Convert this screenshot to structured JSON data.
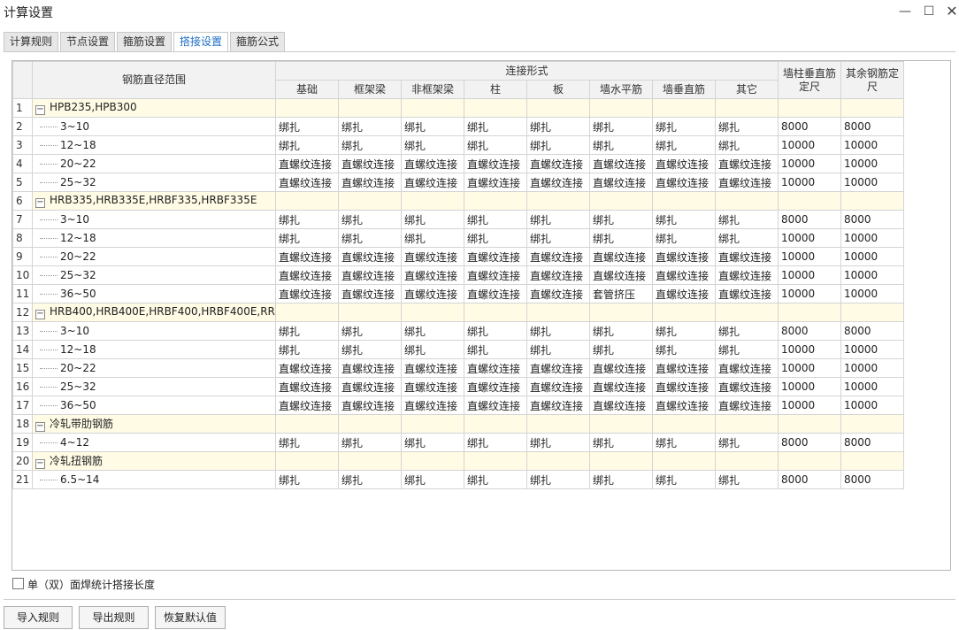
{
  "window": {
    "title": "计算设置"
  },
  "tabs": [
    {
      "label": "计算规则",
      "active": false
    },
    {
      "label": "节点设置",
      "active": false
    },
    {
      "label": "箍筋设置",
      "active": false
    },
    {
      "label": "搭接设置",
      "active": true
    },
    {
      "label": "箍筋公式",
      "active": false
    }
  ],
  "table": {
    "header": {
      "range": "钢筋直径范围",
      "connection_group": "连接形式",
      "columns": [
        "基础",
        "框架梁",
        "非框架梁",
        "柱",
        "板",
        "墙水平筋",
        "墙垂直筋",
        "其它"
      ],
      "wall_column_length": "墙柱垂直筋定尺",
      "other_length": "其余钢筋定尺"
    },
    "rows": [
      {
        "n": "1",
        "type": "group",
        "name": "HPB235,HPB300"
      },
      {
        "n": "2",
        "type": "item",
        "name": "3~10",
        "values": [
          "绑扎",
          "绑扎",
          "绑扎",
          "绑扎",
          "绑扎",
          "绑扎",
          "绑扎",
          "绑扎",
          "8000",
          "8000"
        ]
      },
      {
        "n": "3",
        "type": "item",
        "name": "12~18",
        "values": [
          "绑扎",
          "绑扎",
          "绑扎",
          "绑扎",
          "绑扎",
          "绑扎",
          "绑扎",
          "绑扎",
          "10000",
          "10000"
        ]
      },
      {
        "n": "4",
        "type": "item",
        "name": "20~22",
        "values": [
          "直螺纹连接",
          "直螺纹连接",
          "直螺纹连接",
          "直螺纹连接",
          "直螺纹连接",
          "直螺纹连接",
          "直螺纹连接",
          "直螺纹连接",
          "10000",
          "10000"
        ]
      },
      {
        "n": "5",
        "type": "item",
        "name": "25~32",
        "values": [
          "直螺纹连接",
          "直螺纹连接",
          "直螺纹连接",
          "直螺纹连接",
          "直螺纹连接",
          "直螺纹连接",
          "直螺纹连接",
          "直螺纹连接",
          "10000",
          "10000"
        ]
      },
      {
        "n": "6",
        "type": "group",
        "name": "HRB335,HRB335E,HRBF335,HRBF335E"
      },
      {
        "n": "7",
        "type": "item",
        "name": "3~10",
        "values": [
          "绑扎",
          "绑扎",
          "绑扎",
          "绑扎",
          "绑扎",
          "绑扎",
          "绑扎",
          "绑扎",
          "8000",
          "8000"
        ]
      },
      {
        "n": "8",
        "type": "item",
        "name": "12~18",
        "values": [
          "绑扎",
          "绑扎",
          "绑扎",
          "绑扎",
          "绑扎",
          "绑扎",
          "绑扎",
          "绑扎",
          "10000",
          "10000"
        ]
      },
      {
        "n": "9",
        "type": "item",
        "name": "20~22",
        "values": [
          "直螺纹连接",
          "直螺纹连接",
          "直螺纹连接",
          "直螺纹连接",
          "直螺纹连接",
          "直螺纹连接",
          "直螺纹连接",
          "直螺纹连接",
          "10000",
          "10000"
        ]
      },
      {
        "n": "10",
        "type": "item",
        "name": "25~32",
        "values": [
          "直螺纹连接",
          "直螺纹连接",
          "直螺纹连接",
          "直螺纹连接",
          "直螺纹连接",
          "直螺纹连接",
          "直螺纹连接",
          "直螺纹连接",
          "10000",
          "10000"
        ]
      },
      {
        "n": "11",
        "type": "item",
        "name": "36~50",
        "values": [
          "直螺纹连接",
          "直螺纹连接",
          "直螺纹连接",
          "直螺纹连接",
          "直螺纹连接",
          "套管挤压",
          "直螺纹连接",
          "直螺纹连接",
          "10000",
          "10000"
        ]
      },
      {
        "n": "12",
        "type": "group",
        "name": "HRB400,HRB400E,HRBF400,HRBF400E,RR..."
      },
      {
        "n": "13",
        "type": "item",
        "name": "3~10",
        "values": [
          "绑扎",
          "绑扎",
          "绑扎",
          "绑扎",
          "绑扎",
          "绑扎",
          "绑扎",
          "绑扎",
          "8000",
          "8000"
        ]
      },
      {
        "n": "14",
        "type": "item",
        "name": "12~18",
        "values": [
          "绑扎",
          "绑扎",
          "绑扎",
          "绑扎",
          "绑扎",
          "绑扎",
          "绑扎",
          "绑扎",
          "10000",
          "10000"
        ]
      },
      {
        "n": "15",
        "type": "item",
        "name": "20~22",
        "values": [
          "直螺纹连接",
          "直螺纹连接",
          "直螺纹连接",
          "直螺纹连接",
          "直螺纹连接",
          "直螺纹连接",
          "直螺纹连接",
          "直螺纹连接",
          "10000",
          "10000"
        ]
      },
      {
        "n": "16",
        "type": "item",
        "name": "25~32",
        "values": [
          "直螺纹连接",
          "直螺纹连接",
          "直螺纹连接",
          "直螺纹连接",
          "直螺纹连接",
          "直螺纹连接",
          "直螺纹连接",
          "直螺纹连接",
          "10000",
          "10000"
        ]
      },
      {
        "n": "17",
        "type": "item",
        "name": "36~50",
        "values": [
          "直螺纹连接",
          "直螺纹连接",
          "直螺纹连接",
          "直螺纹连接",
          "直螺纹连接",
          "直螺纹连接",
          "直螺纹连接",
          "直螺纹连接",
          "10000",
          "10000"
        ]
      },
      {
        "n": "18",
        "type": "group",
        "name": "冷轧带肋钢筋"
      },
      {
        "n": "19",
        "type": "item",
        "name": "4~12",
        "values": [
          "绑扎",
          "绑扎",
          "绑扎",
          "绑扎",
          "绑扎",
          "绑扎",
          "绑扎",
          "绑扎",
          "8000",
          "8000"
        ]
      },
      {
        "n": "20",
        "type": "group",
        "name": "冷轧扭钢筋"
      },
      {
        "n": "21",
        "type": "item",
        "name": "6.5~14",
        "values": [
          "绑扎",
          "绑扎",
          "绑扎",
          "绑扎",
          "绑扎",
          "绑扎",
          "绑扎",
          "绑扎",
          "8000",
          "8000"
        ]
      }
    ]
  },
  "options": {
    "weld_checkbox_label": "单（双）面焊统计搭接长度",
    "weld_checked": false
  },
  "buttons": {
    "import": "导入规则",
    "export": "导出规则",
    "restore": "恢复默认值"
  },
  "icons": {
    "minimize": "minimize-icon",
    "maximize": "maximize-icon",
    "close": "close-icon",
    "collapse": "collapse-icon"
  }
}
